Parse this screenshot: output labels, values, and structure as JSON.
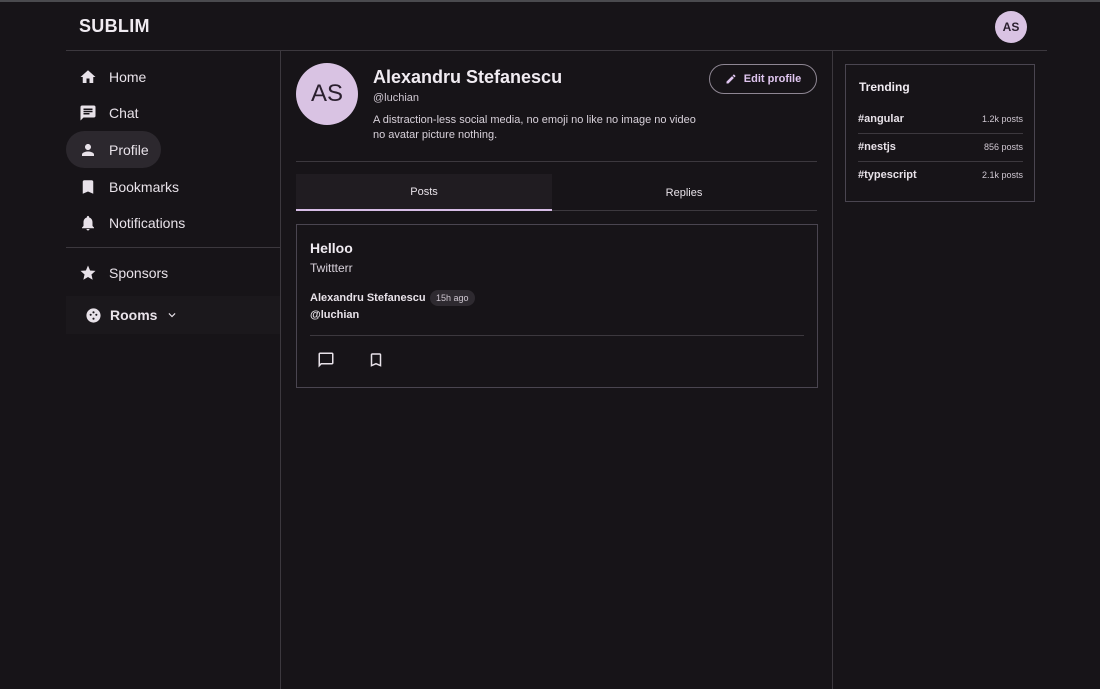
{
  "header": {
    "brand": "SUBLIM",
    "avatar_initials": "AS"
  },
  "sidebar": {
    "items": [
      {
        "label": "Home",
        "icon": "home-icon"
      },
      {
        "label": "Chat",
        "icon": "chat-icon"
      },
      {
        "label": "Profile",
        "icon": "person-icon",
        "active": true
      },
      {
        "label": "Bookmarks",
        "icon": "bookmark-icon"
      },
      {
        "label": "Notifications",
        "icon": "bell-icon"
      }
    ],
    "sponsors": {
      "label": "Sponsors",
      "icon": "star-icon"
    },
    "rooms": {
      "label": "Rooms",
      "icon": "rooms-icon"
    }
  },
  "profile": {
    "initials": "AS",
    "name": "Alexandru Stefanescu",
    "handle": "@luchian",
    "bio": "A distraction-less social media, no emoji no like no image no video no avatar picture nothing.",
    "edit_label": "Edit profile"
  },
  "tabs": [
    {
      "label": "Posts",
      "active": true
    },
    {
      "label": "Replies",
      "active": false
    }
  ],
  "post": {
    "title": "Helloo",
    "body": "Twittterr",
    "author": "Alexandru Stefanescu",
    "time": "15h ago",
    "handle": "@luchian"
  },
  "trending": {
    "title": "Trending",
    "items": [
      {
        "tag": "#angular",
        "count": "1.2k posts"
      },
      {
        "tag": "#nestjs",
        "count": "856 posts"
      },
      {
        "tag": "#typescript",
        "count": "2.1k posts"
      }
    ]
  },
  "colors": {
    "accent": "#d7bde6",
    "avatar_bg": "#d9c3e3",
    "background": "#171418"
  }
}
